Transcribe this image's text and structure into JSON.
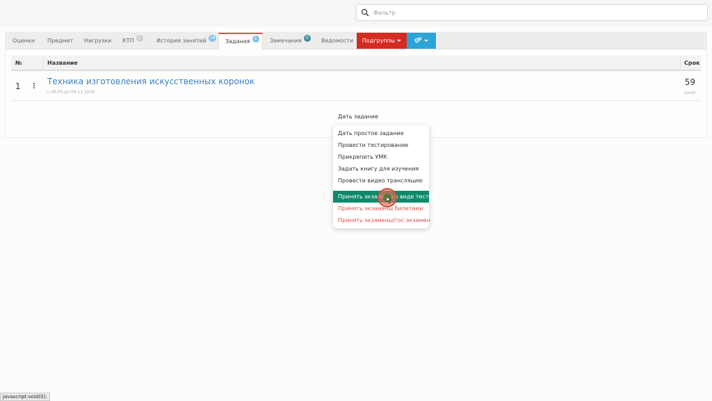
{
  "filter": {
    "placeholder": "Фильтр",
    "value": ""
  },
  "tabs": [
    {
      "label": "Оценки"
    },
    {
      "label": "Предмет"
    },
    {
      "label": "Нагрузки"
    },
    {
      "label": "КТП",
      "badge": "1"
    },
    {
      "label": "История занятий",
      "badge": "18"
    },
    {
      "label": "Задания",
      "badge": "1"
    },
    {
      "label": "Замечания",
      "badge": "0"
    },
    {
      "label": "Ведомости"
    }
  ],
  "subgroups_label": "Подгруппы",
  "table": {
    "headers": {
      "num": "№",
      "name": "Название",
      "term": "Срок"
    },
    "rows": [
      {
        "num": "1",
        "title": "Техника изготовления искусственных коронок",
        "dates": "с 08.09 до 06.11.2026",
        "days": "59",
        "days_label": "дней"
      }
    ]
  },
  "dropdown": {
    "header": "Дать задание",
    "items": [
      "Дать простое задание",
      "Провести тестирование",
      "Прикрепить УМК",
      "Задать книгу для изучения",
      "Провести видео трансляцию",
      "Принять экзамены в виде тестов",
      "Принять экзамены билетами",
      "Принять экзамены/гос экзамен"
    ]
  },
  "status_bar": "javascript:void(0);",
  "colors": {
    "accent_red": "#d42b23",
    "accent_blue": "#2ba4d8",
    "highlight": "#0d8a6a",
    "link": "#3b7fbf"
  }
}
